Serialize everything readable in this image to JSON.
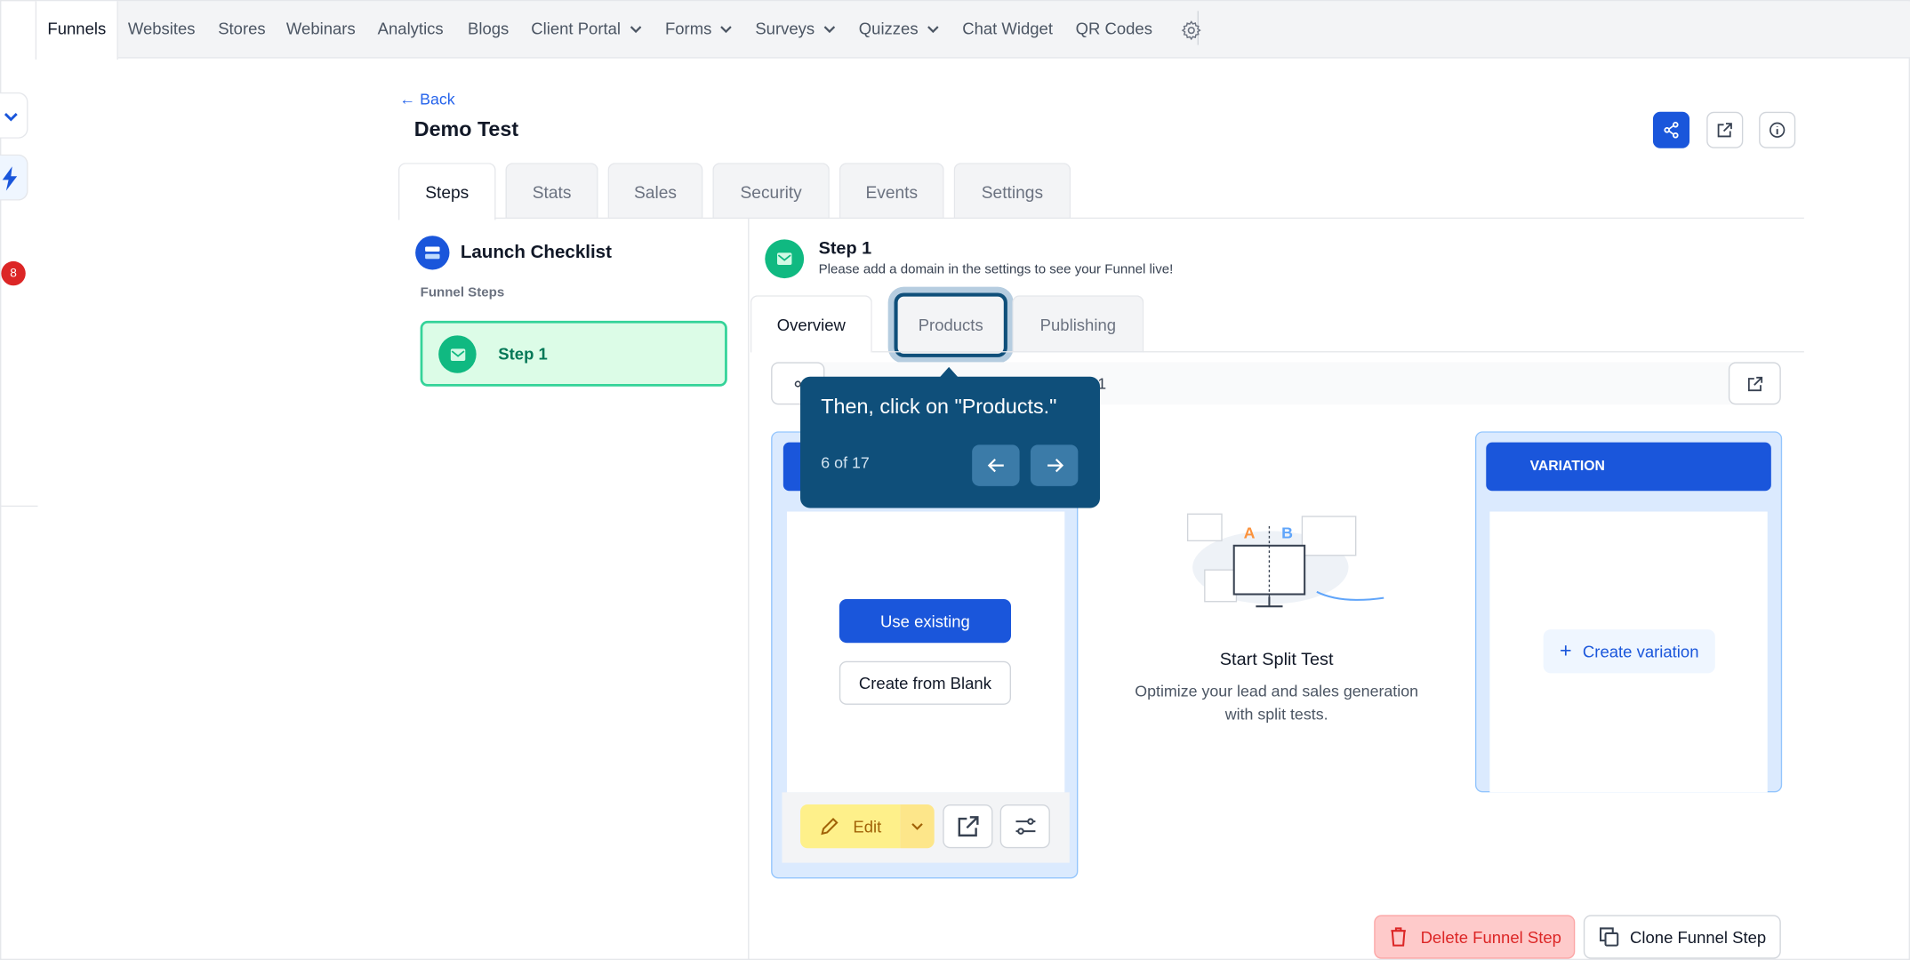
{
  "nav": {
    "items": [
      "Funnels",
      "Websites",
      "Stores",
      "Webinars",
      "Analytics",
      "Blogs",
      "Client Portal",
      "Forms",
      "Surveys",
      "Quizzes",
      "Chat Widget",
      "QR Codes"
    ],
    "active": "Funnels"
  },
  "sidebar": {
    "notification_count": "8"
  },
  "header": {
    "back_label": "← Back",
    "title": "Demo Test"
  },
  "tabs": [
    "Steps",
    "Stats",
    "Sales",
    "Security",
    "Events",
    "Settings"
  ],
  "active_tab": "Steps",
  "checklist": {
    "title": "Launch Checklist",
    "steps_heading": "Funnel Steps",
    "step_label": "Step 1"
  },
  "step": {
    "title": "Step 1",
    "subtitle": "Please add a domain in the settings to see your Funnel live!",
    "subtabs": [
      "Overview",
      "Products",
      "Publishing"
    ],
    "url_text": "1"
  },
  "tooltip": {
    "text": "Then, click on \"Products.\"",
    "progress": "6 of 17"
  },
  "main_card": {
    "use_existing": "Use existing",
    "create_blank": "Create from Blank",
    "edit": "Edit"
  },
  "split_test": {
    "ab_a": "A",
    "ab_b": "B",
    "title": "Start Split Test",
    "desc_line1": "Optimize your lead and sales generation",
    "desc_line2": "with split tests."
  },
  "variation": {
    "header": "VARIATION",
    "create": "Create variation"
  },
  "footer": {
    "delete": "Delete Funnel Step",
    "clone": "Clone Funnel Step"
  },
  "colors": {
    "primary": "#1a56db",
    "green": "#10b981",
    "tooltip": "#0f4f7a",
    "edit_bg": "#fef08a",
    "delete_bg": "#fecaca"
  }
}
